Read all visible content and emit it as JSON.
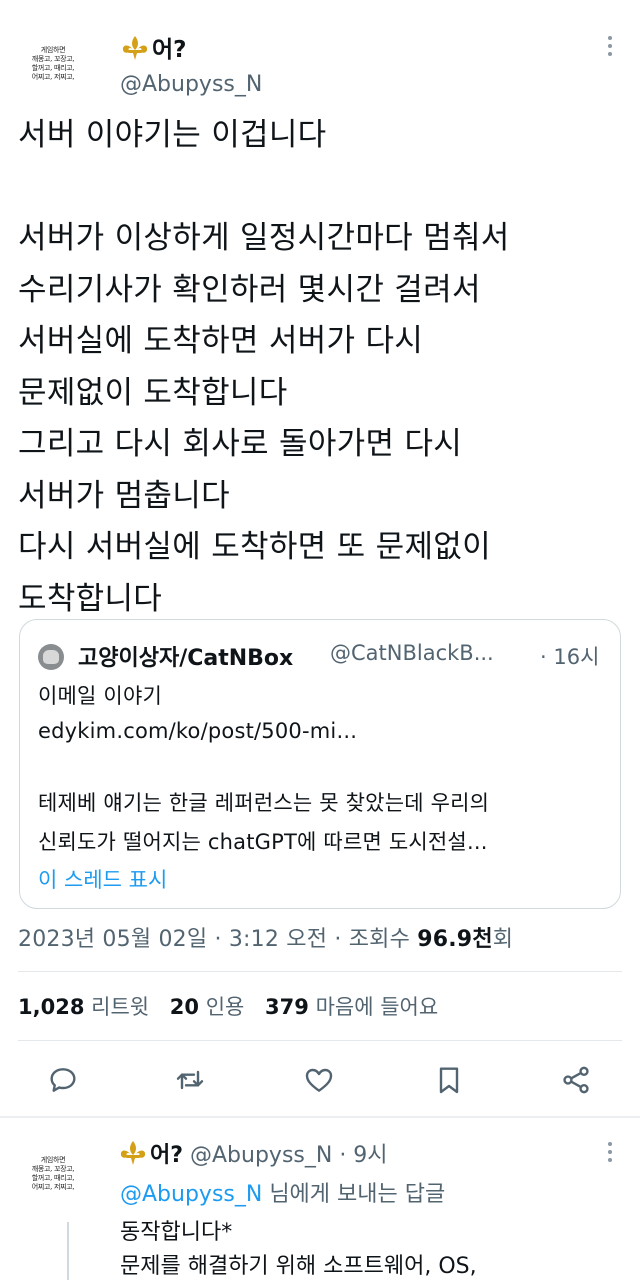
{
  "tweet": {
    "author_name": "어?",
    "author_handle": "@Abupyss_N",
    "avatar_text": [
      "게임하면",
      "깨몽고, 꼬장고,",
      "할꺼고, 때리고,",
      "어찌고, 저찌고,"
    ],
    "text_lines": [
      "서버 이야기는 이겁니다",
      "",
      "서버가 이상하게 일정시간마다 멈춰서",
      "수리기사가 확인하러 몇시간 걸려서",
      "서버실에 도착하면 서버가 다시",
      "문제없이 도착합니다",
      "그리고 다시 회사로 돌아가면 다시",
      "서버가 멈춥니다",
      "다시 서버실에 도착하면 또 문제없이",
      "도착합니다"
    ],
    "timestamp_prefix": "2023년 05월 02일 · 3:12 오전 · 조회수 ",
    "views": "96.9천",
    "views_suffix": "회",
    "stats": {
      "retweets_count": "1,028",
      "retweets_label": "리트윗",
      "quotes_count": "20",
      "quotes_label": "인용",
      "likes_count": "379",
      "likes_label": "마음에 들어요"
    }
  },
  "quote": {
    "name": "고양이상자/CatNBox",
    "handle": "@CatNBlackB...",
    "time": "· 16시",
    "lines": [
      "이메일 이야기",
      "edykim.com/ko/post/500-mi...",
      "",
      "테제베 얘기는 한글 레퍼런스는 못 찾았는데 우리의",
      "신뢰도가 떨어지는 chatGPT에 따르면 도시전설..."
    ],
    "show_thread": "이 스레드 표시"
  },
  "reply": {
    "author_name": "어?",
    "meta": " @Abupyss_N · 9시",
    "to_mention": "@Abupyss_N",
    "to_suffix": " 님에게 보내는 답글",
    "lines": [
      "동작합니다*",
      "문제를 해결하기 위해 소프트웨어, OS,"
    ]
  },
  "colors": {
    "blue": "#1d9bf0",
    "gray": "#536471",
    "gold": "#d4a017"
  },
  "icons": [
    "fleur-de-lis-icon",
    "more-icon",
    "reply-icon",
    "retweet-icon",
    "like-icon",
    "bookmark-icon",
    "share-icon"
  ]
}
